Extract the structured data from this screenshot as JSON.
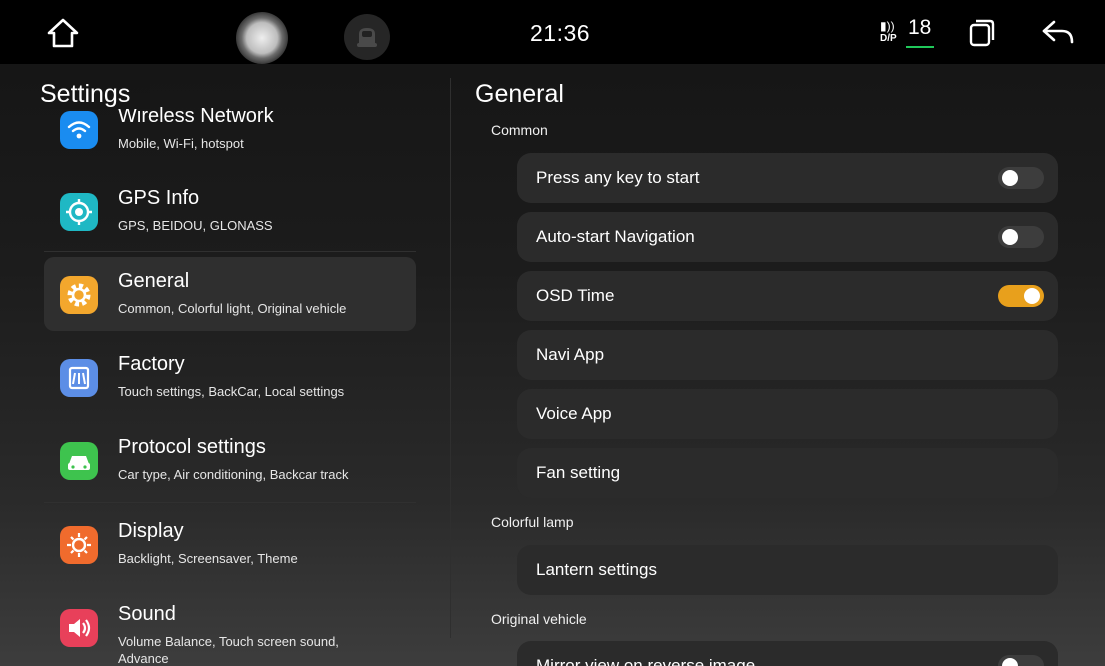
{
  "status_bar": {
    "time": "21:36",
    "volume_label": "D/P",
    "volume_value": "18",
    "icons": [
      "home-icon",
      "assistant-orb-icon",
      "car-icon",
      "speaker-icon",
      "recent-apps-icon",
      "back-icon"
    ],
    "accent": "#20c85a"
  },
  "left": {
    "title": "Settings",
    "items": [
      {
        "title": "Wireless Network",
        "subtitle": "Mobile, Wi-Fi, hotspot",
        "icon": "wifi-icon",
        "color": "#1a8cf0"
      },
      {
        "title": "GPS Info",
        "subtitle": "GPS, BEIDOU, GLONASS",
        "icon": "gps-icon",
        "color": "#1fb8c4"
      },
      {
        "title": "General",
        "subtitle": "Common, Colorful light, Original vehicle",
        "icon": "gear-icon",
        "color": "#f3a72d",
        "selected": true
      },
      {
        "title": "Factory",
        "subtitle": "Touch settings, BackCar, Local settings",
        "icon": "factory-icon",
        "color": "#5c8ee6"
      },
      {
        "title": "Protocol settings",
        "subtitle": "Car type, Air conditioning, Backcar track",
        "icon": "car-protocol-icon",
        "color": "#3ec34e"
      },
      {
        "title": "Display",
        "subtitle": "Backlight, Screensaver, Theme",
        "icon": "brightness-icon",
        "color": "#f06b2d"
      },
      {
        "title": "Sound",
        "subtitle": "Volume Balance, Touch screen sound, Advance",
        "icon": "speaker-icon",
        "color": "#e8405a"
      }
    ]
  },
  "right": {
    "title": "General",
    "sections": {
      "common": "Common",
      "colorful": "Colorful lamp",
      "original": "Original vehicle"
    },
    "rows": {
      "press_any_key": {
        "label": "Press any key to start",
        "toggle": "off"
      },
      "auto_nav": {
        "label": "Auto-start Navigation",
        "toggle": "off"
      },
      "osd_time": {
        "label": "OSD Time",
        "toggle": "on"
      },
      "navi_app": {
        "label": "Navi App"
      },
      "voice_app": {
        "label": "Voice App"
      },
      "fan_setting": {
        "label": "Fan setting"
      },
      "lantern": {
        "label": "Lantern settings"
      },
      "mirror": {
        "label": "Mirror view on reverse image",
        "toggle": "off"
      }
    },
    "toggle_on_color": "#e8a01c"
  }
}
